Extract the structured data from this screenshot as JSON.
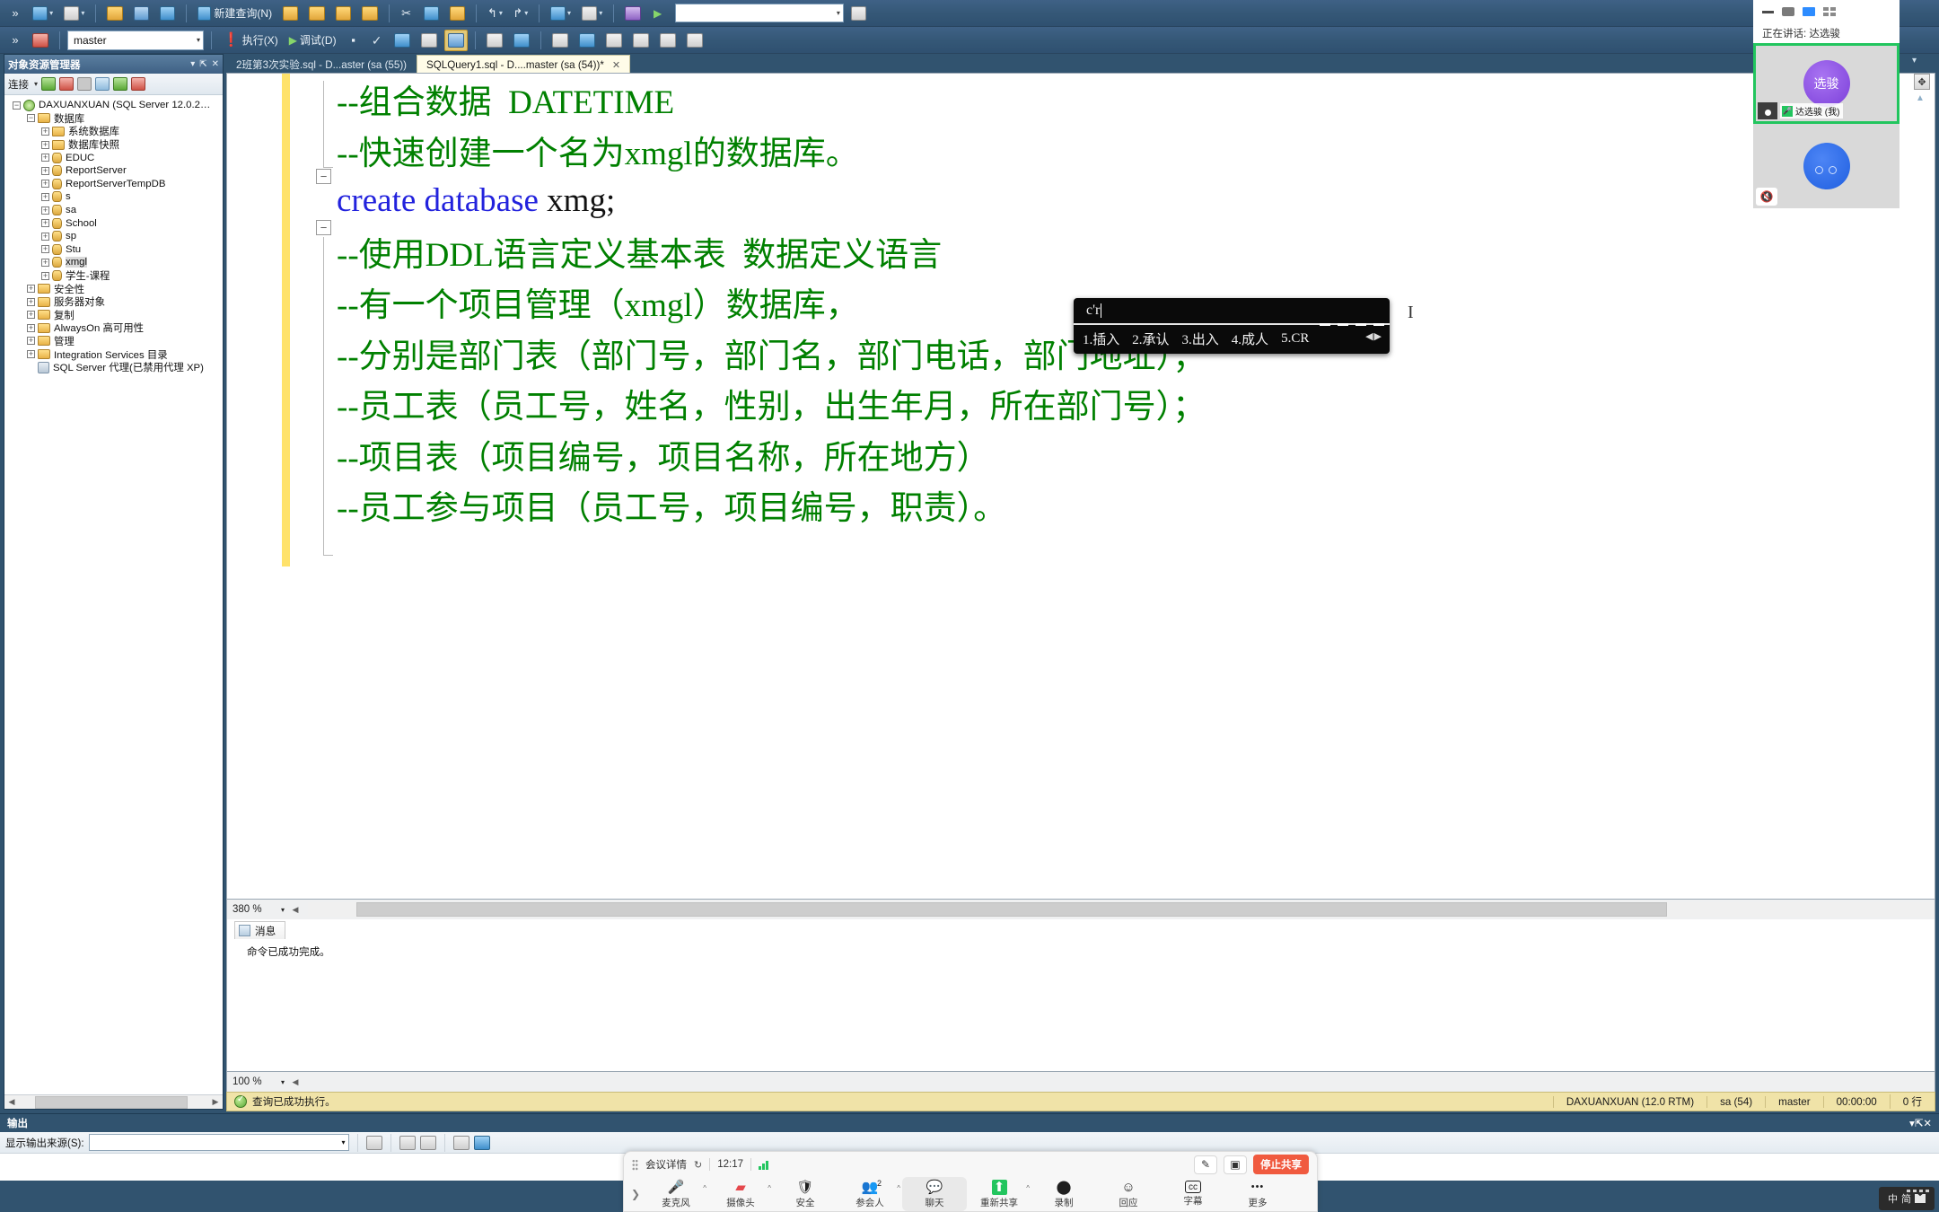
{
  "toolbar_row1": {
    "items": [
      {
        "name": "new-query-dropdown",
        "label": "",
        "icon": "doc-blue"
      },
      {
        "name": "open-file-button",
        "label": "",
        "icon": "folder-open"
      },
      {
        "name": "save-button",
        "label": "",
        "icon": "save"
      },
      {
        "name": "save-all-button",
        "label": "",
        "icon": "save-all"
      },
      {
        "name": "new-query-button",
        "label": "新建查询(N)",
        "icon": "new-query"
      },
      {
        "name": "database-engine-query-button",
        "label": "",
        "icon": "db-query"
      },
      {
        "name": "analysis-mdx-query-button",
        "label": "",
        "icon": "mdx-query"
      },
      {
        "name": "analysis-dmx-query-button",
        "label": "",
        "icon": "dmx-query"
      },
      {
        "name": "analysis-xmla-query-button",
        "label": "",
        "icon": "xmla-query"
      },
      {
        "name": "cut-button",
        "label": "",
        "icon": "scissors"
      },
      {
        "name": "copy-button",
        "label": "",
        "icon": "copy"
      },
      {
        "name": "paste-button",
        "label": "",
        "icon": "paste"
      },
      {
        "name": "undo-button",
        "label": "",
        "icon": "undo"
      },
      {
        "name": "redo-button",
        "label": "",
        "icon": "redo"
      },
      {
        "name": "navigate-backward-button",
        "label": "",
        "icon": "nav-back"
      },
      {
        "name": "navigate-forward-button",
        "label": "",
        "icon": "nav-forward"
      },
      {
        "name": "show-diagram-button",
        "label": "",
        "icon": "diagram"
      }
    ]
  },
  "toolbar_row2": {
    "database_combo_value": "master",
    "execute_label": "执行(X)",
    "debug_label": "调试(D)",
    "stop_title": "停止",
    "parse_title": "分析",
    "search_placeholder": ""
  },
  "object_explorer": {
    "title": "对象资源管理器",
    "connect_label": "连接",
    "toolbar_icons": [
      "connect-icon",
      "disconnect-icon",
      "stop-icon",
      "filter-icon",
      "refresh-icon",
      "scripts-icon"
    ],
    "tree": [
      {
        "label": "DAXUANXUAN (SQL Server 12.0.2…",
        "indent": 0,
        "icon": "server",
        "state": "minus"
      },
      {
        "label": "数据库",
        "indent": 1,
        "icon": "folder",
        "state": "minus"
      },
      {
        "label": "系统数据库",
        "indent": 2,
        "icon": "folder",
        "state": "plus"
      },
      {
        "label": "数据库快照",
        "indent": 2,
        "icon": "folder",
        "state": "plus"
      },
      {
        "label": "EDUC",
        "indent": 2,
        "icon": "database",
        "state": "plus"
      },
      {
        "label": "ReportServer",
        "indent": 2,
        "icon": "database",
        "state": "plus"
      },
      {
        "label": "ReportServerTempDB",
        "indent": 2,
        "icon": "database",
        "state": "plus"
      },
      {
        "label": "s",
        "indent": 2,
        "icon": "database",
        "state": "plus"
      },
      {
        "label": "sa",
        "indent": 2,
        "icon": "database",
        "state": "plus"
      },
      {
        "label": "School",
        "indent": 2,
        "icon": "database",
        "state": "plus"
      },
      {
        "label": "sp",
        "indent": 2,
        "icon": "database",
        "state": "plus"
      },
      {
        "label": "Stu",
        "indent": 2,
        "icon": "database",
        "state": "plus"
      },
      {
        "label": "xmgl",
        "indent": 2,
        "icon": "database",
        "state": "plus",
        "selected": true
      },
      {
        "label": "学生-课程",
        "indent": 2,
        "icon": "database",
        "state": "plus"
      },
      {
        "label": "安全性",
        "indent": 1,
        "icon": "folder",
        "state": "plus"
      },
      {
        "label": "服务器对象",
        "indent": 1,
        "icon": "folder",
        "state": "plus"
      },
      {
        "label": "复制",
        "indent": 1,
        "icon": "folder",
        "state": "plus"
      },
      {
        "label": "AlwaysOn 高可用性",
        "indent": 1,
        "icon": "folder",
        "state": "plus"
      },
      {
        "label": "管理",
        "indent": 1,
        "icon": "folder",
        "state": "plus"
      },
      {
        "label": "Integration Services 目录",
        "indent": 1,
        "icon": "folder",
        "state": "plus"
      },
      {
        "label": "SQL Server 代理(已禁用代理 XP)",
        "indent": 1,
        "icon": "agent",
        "state": "none"
      }
    ]
  },
  "tabs": [
    {
      "label": "2班第3次实验.sql - D...aster (sa (55))",
      "active": false,
      "closable": false
    },
    {
      "label": "SQLQuery1.sql - D....master (sa (54))*",
      "active": true,
      "closable": true,
      "close": "✕"
    }
  ],
  "editor": {
    "lines": [
      {
        "segments": [
          {
            "text": "--组合数据  DATETIME",
            "cls": "cmt"
          }
        ]
      },
      {
        "segments": [
          {
            "text": "--快速创建一个名为xmgl的数据库。",
            "cls": "cmt"
          }
        ]
      },
      {
        "segments": [
          {
            "text": "create database ",
            "cls": "kw"
          },
          {
            "text": "xmg;",
            "cls": "idn"
          }
        ]
      },
      {
        "segments": [
          {
            "text": "--使用DDL语言定义基本表  数据定义语言",
            "cls": "cmt"
          }
        ]
      },
      {
        "segments": [
          {
            "text": "--有一个项目管理（xmgl）数据库，",
            "cls": "cmt"
          }
        ]
      },
      {
        "segments": [
          {
            "text": "--分别是部门表（部门号，部门名，部门电话，部门地址）；",
            "cls": "cmt"
          }
        ]
      },
      {
        "segments": [
          {
            "text": "--员工表（员工号，姓名，性别，出生年月，所在部门号）；",
            "cls": "cmt"
          }
        ]
      },
      {
        "segments": [
          {
            "text": "--项目表（项目编号，项目名称，所在地方）",
            "cls": "cmt"
          }
        ]
      },
      {
        "segments": [
          {
            "text": "--员工参与项目（员工号，项目编号，职责）。",
            "cls": "cmt"
          }
        ]
      }
    ],
    "zoom_level": "380 %"
  },
  "ime": {
    "composition": "c'r",
    "candidates": [
      "1.插入",
      "2.承认",
      "3.出入",
      "4.成人",
      "5.CR"
    ],
    "nav_prev": "◀",
    "nav_next": "▶"
  },
  "messages": {
    "tab_label": "消息",
    "body": "命令已成功完成。",
    "zoom_level": "100 %"
  },
  "status_bar": {
    "message": "查询已成功执行。",
    "server": "DAXUANXUAN (12.0 RTM)",
    "login": "sa (54)",
    "database": "master",
    "duration": "00:00:00",
    "rows": "0 行"
  },
  "output_pane": {
    "title": "输出",
    "source_label": "显示输出来源(S):",
    "source_value": ""
  },
  "zoom_panel": {
    "speaker_label": "正在讲话: 达选骏",
    "tile1": {
      "avatar_initials": "选骏",
      "name": "达选骏 (我)",
      "muted": false
    },
    "tile2": {
      "muted": true
    },
    "window_icons": [
      "minimize-icon",
      "window-icon",
      "split-view-icon",
      "gallery-view-icon"
    ]
  },
  "zoom_bar": {
    "meeting_info_label": "会议详情",
    "timer": "12:17",
    "stop_share_label": "停止共享",
    "annotate_icon": "pen-icon",
    "remote_icon": "remote-control-icon",
    "controls": [
      {
        "name": "microphone",
        "label": "麦克风",
        "icon": "mic-icon",
        "chevron": true,
        "badge": null,
        "highlight": false
      },
      {
        "name": "camera",
        "label": "摄像头",
        "icon": "camera-off-icon",
        "chevron": true,
        "badge": null,
        "highlight": false
      },
      {
        "name": "security",
        "label": "安全",
        "icon": "shield-icon",
        "chevron": false,
        "badge": null,
        "highlight": false
      },
      {
        "name": "participants",
        "label": "参会人",
        "icon": "participants-icon",
        "chevron": true,
        "badge": "2",
        "highlight": false
      },
      {
        "name": "chat",
        "label": "聊天",
        "icon": "chat-icon",
        "chevron": false,
        "badge": null,
        "highlight": true
      },
      {
        "name": "new-share",
        "label": "重新共享",
        "icon": "share-screen-icon",
        "chevron": true,
        "badge": null,
        "highlight": false
      },
      {
        "name": "record",
        "label": "录制",
        "icon": "record-icon",
        "chevron": false,
        "badge": null,
        "highlight": false
      },
      {
        "name": "reactions",
        "label": "回应",
        "icon": "reactions-icon",
        "chevron": false,
        "badge": null,
        "highlight": false
      },
      {
        "name": "captions",
        "label": "字幕",
        "icon": "cc-icon",
        "chevron": false,
        "badge": null,
        "highlight": false
      },
      {
        "name": "more",
        "label": "更多",
        "icon": "ellipsis-icon",
        "chevron": false,
        "badge": null,
        "highlight": false
      }
    ]
  },
  "ime_tray": {
    "lang": "中",
    "mode": "简"
  },
  "colors": {
    "accent_blue": "#31536f",
    "comment_green": "#008000",
    "keyword_blue": "#2222dd",
    "status_yellow": "#f0e3a8",
    "zoom_red": "#f05a3f",
    "active_green": "#22c55e"
  }
}
